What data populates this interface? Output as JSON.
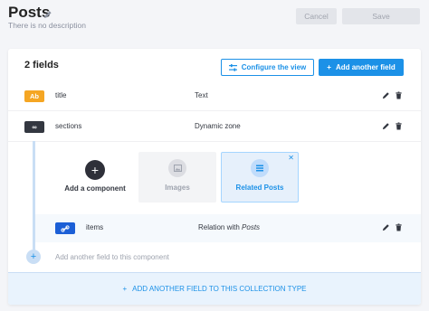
{
  "header": {
    "title": "Posts",
    "description": "There is no description",
    "cancel_label": "Cancel",
    "save_label": "Save"
  },
  "card": {
    "fields_count": "2 fields",
    "configure_label": "Configure the view",
    "add_field_label": "Add another field"
  },
  "fields": [
    {
      "name": "title",
      "type": "Text",
      "badge": "Ab",
      "icon": "text-type-icon"
    },
    {
      "name": "sections",
      "type": "Dynamic zone",
      "badge": "∞",
      "icon": "dynamic-zone-icon"
    }
  ],
  "components": {
    "add_label": "Add a component",
    "items": [
      {
        "label": "Images",
        "icon": "image-icon",
        "selected": false
      },
      {
        "label": "Related Posts",
        "icon": "list-icon",
        "selected": true
      }
    ]
  },
  "component_field": {
    "name": "items",
    "type_prefix": "Relation with ",
    "type_target": "Posts",
    "icon": "relation-icon"
  },
  "add_to_component_label": "Add another field to this component",
  "footer_label": "ADD ANOTHER FIELD TO THIS COLLECTION TYPE",
  "colors": {
    "primary": "#1c91e7",
    "text_badge": "#f5a623",
    "dz_badge": "#333740",
    "relation_badge": "#1c5fd6"
  }
}
